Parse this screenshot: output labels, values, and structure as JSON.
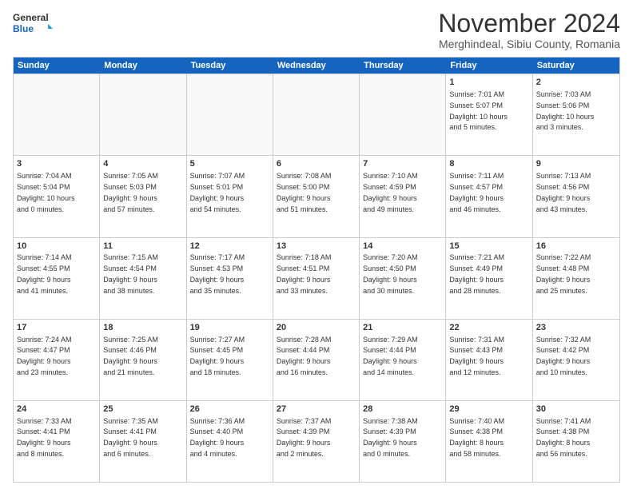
{
  "logo": {
    "line1": "General",
    "line2": "Blue"
  },
  "title": "November 2024",
  "location": "Merghindeal, Sibiu County, Romania",
  "days_header": [
    "Sunday",
    "Monday",
    "Tuesday",
    "Wednesday",
    "Thursday",
    "Friday",
    "Saturday"
  ],
  "weeks": [
    [
      {
        "day": "",
        "info": ""
      },
      {
        "day": "",
        "info": ""
      },
      {
        "day": "",
        "info": ""
      },
      {
        "day": "",
        "info": ""
      },
      {
        "day": "",
        "info": ""
      },
      {
        "day": "1",
        "info": "Sunrise: 7:01 AM\nSunset: 5:07 PM\nDaylight: 10 hours\nand 5 minutes."
      },
      {
        "day": "2",
        "info": "Sunrise: 7:03 AM\nSunset: 5:06 PM\nDaylight: 10 hours\nand 3 minutes."
      }
    ],
    [
      {
        "day": "3",
        "info": "Sunrise: 7:04 AM\nSunset: 5:04 PM\nDaylight: 10 hours\nand 0 minutes."
      },
      {
        "day": "4",
        "info": "Sunrise: 7:05 AM\nSunset: 5:03 PM\nDaylight: 9 hours\nand 57 minutes."
      },
      {
        "day": "5",
        "info": "Sunrise: 7:07 AM\nSunset: 5:01 PM\nDaylight: 9 hours\nand 54 minutes."
      },
      {
        "day": "6",
        "info": "Sunrise: 7:08 AM\nSunset: 5:00 PM\nDaylight: 9 hours\nand 51 minutes."
      },
      {
        "day": "7",
        "info": "Sunrise: 7:10 AM\nSunset: 4:59 PM\nDaylight: 9 hours\nand 49 minutes."
      },
      {
        "day": "8",
        "info": "Sunrise: 7:11 AM\nSunset: 4:57 PM\nDaylight: 9 hours\nand 46 minutes."
      },
      {
        "day": "9",
        "info": "Sunrise: 7:13 AM\nSunset: 4:56 PM\nDaylight: 9 hours\nand 43 minutes."
      }
    ],
    [
      {
        "day": "10",
        "info": "Sunrise: 7:14 AM\nSunset: 4:55 PM\nDaylight: 9 hours\nand 41 minutes."
      },
      {
        "day": "11",
        "info": "Sunrise: 7:15 AM\nSunset: 4:54 PM\nDaylight: 9 hours\nand 38 minutes."
      },
      {
        "day": "12",
        "info": "Sunrise: 7:17 AM\nSunset: 4:53 PM\nDaylight: 9 hours\nand 35 minutes."
      },
      {
        "day": "13",
        "info": "Sunrise: 7:18 AM\nSunset: 4:51 PM\nDaylight: 9 hours\nand 33 minutes."
      },
      {
        "day": "14",
        "info": "Sunrise: 7:20 AM\nSunset: 4:50 PM\nDaylight: 9 hours\nand 30 minutes."
      },
      {
        "day": "15",
        "info": "Sunrise: 7:21 AM\nSunset: 4:49 PM\nDaylight: 9 hours\nand 28 minutes."
      },
      {
        "day": "16",
        "info": "Sunrise: 7:22 AM\nSunset: 4:48 PM\nDaylight: 9 hours\nand 25 minutes."
      }
    ],
    [
      {
        "day": "17",
        "info": "Sunrise: 7:24 AM\nSunset: 4:47 PM\nDaylight: 9 hours\nand 23 minutes."
      },
      {
        "day": "18",
        "info": "Sunrise: 7:25 AM\nSunset: 4:46 PM\nDaylight: 9 hours\nand 21 minutes."
      },
      {
        "day": "19",
        "info": "Sunrise: 7:27 AM\nSunset: 4:45 PM\nDaylight: 9 hours\nand 18 minutes."
      },
      {
        "day": "20",
        "info": "Sunrise: 7:28 AM\nSunset: 4:44 PM\nDaylight: 9 hours\nand 16 minutes."
      },
      {
        "day": "21",
        "info": "Sunrise: 7:29 AM\nSunset: 4:44 PM\nDaylight: 9 hours\nand 14 minutes."
      },
      {
        "day": "22",
        "info": "Sunrise: 7:31 AM\nSunset: 4:43 PM\nDaylight: 9 hours\nand 12 minutes."
      },
      {
        "day": "23",
        "info": "Sunrise: 7:32 AM\nSunset: 4:42 PM\nDaylight: 9 hours\nand 10 minutes."
      }
    ],
    [
      {
        "day": "24",
        "info": "Sunrise: 7:33 AM\nSunset: 4:41 PM\nDaylight: 9 hours\nand 8 minutes."
      },
      {
        "day": "25",
        "info": "Sunrise: 7:35 AM\nSunset: 4:41 PM\nDaylight: 9 hours\nand 6 minutes."
      },
      {
        "day": "26",
        "info": "Sunrise: 7:36 AM\nSunset: 4:40 PM\nDaylight: 9 hours\nand 4 minutes."
      },
      {
        "day": "27",
        "info": "Sunrise: 7:37 AM\nSunset: 4:39 PM\nDaylight: 9 hours\nand 2 minutes."
      },
      {
        "day": "28",
        "info": "Sunrise: 7:38 AM\nSunset: 4:39 PM\nDaylight: 9 hours\nand 0 minutes."
      },
      {
        "day": "29",
        "info": "Sunrise: 7:40 AM\nSunset: 4:38 PM\nDaylight: 8 hours\nand 58 minutes."
      },
      {
        "day": "30",
        "info": "Sunrise: 7:41 AM\nSunset: 4:38 PM\nDaylight: 8 hours\nand 56 minutes."
      }
    ]
  ]
}
